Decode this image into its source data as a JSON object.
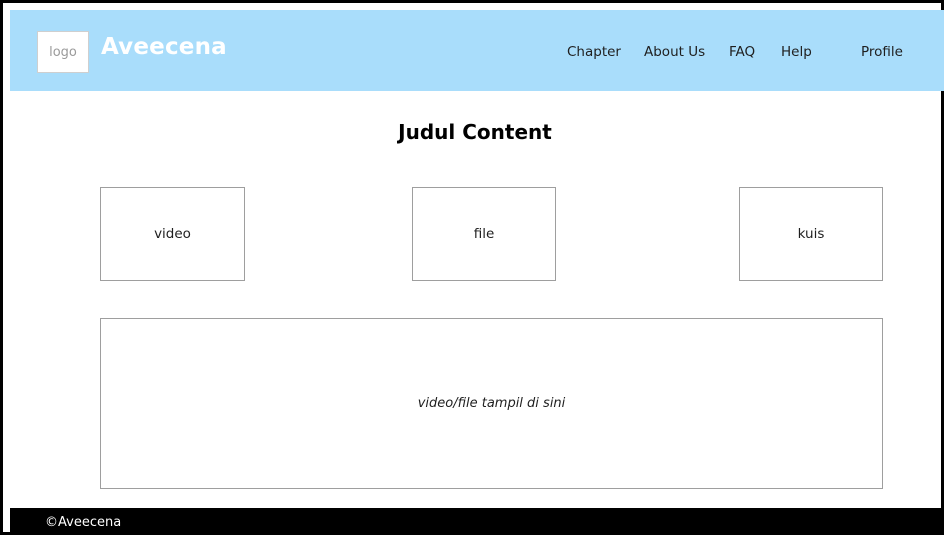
{
  "header": {
    "logo_text": "logo",
    "brand": "Aveecena",
    "nav": {
      "chapter": "Chapter",
      "about": "About Us",
      "faq": "FAQ",
      "help": "Help",
      "profile": "Profile"
    }
  },
  "main": {
    "title": "Judul Content",
    "cards": {
      "video": "video",
      "file": "file",
      "kuis": "kuis"
    },
    "display_placeholder": "video/file tampil di sini"
  },
  "footer": {
    "copyright": "©Aveecena"
  },
  "colors": {
    "navbar_bg": "#a9ddfb",
    "brand_text": "#ffffff",
    "footer_bg": "#000000"
  }
}
